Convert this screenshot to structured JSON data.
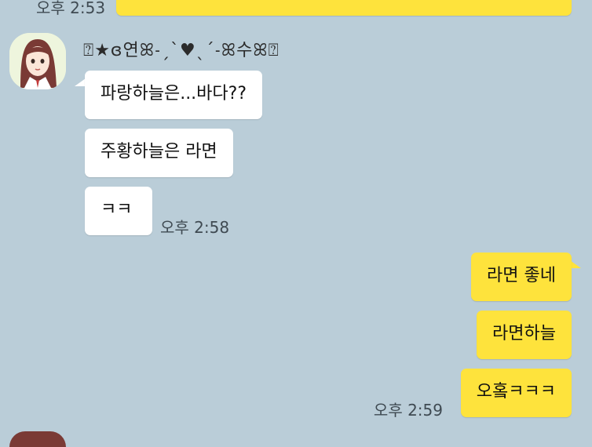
{
  "top": {
    "time": "오후 2:53"
  },
  "sender": {
    "name": "⍰★ɞ연ꕤ˗ˏˋ♥ˎˊ˗ꕤ수ꕤ⍰"
  },
  "incoming": {
    "messages": [
      "파랑하늘은...바다??",
      "주황하늘은 라면",
      "ㅋㅋ"
    ],
    "time": "오후 2:58"
  },
  "outgoing": {
    "messages": [
      "라면 좋네",
      "라면하늘",
      "오홐ㅋㅋㅋ"
    ],
    "time": "오후 2:59"
  }
}
